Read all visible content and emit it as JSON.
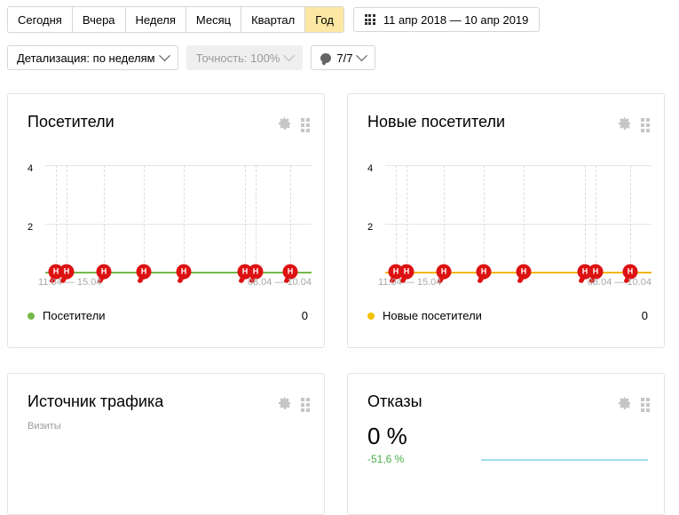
{
  "toolbar": {
    "periods": [
      {
        "label": "Сегодня",
        "active": false
      },
      {
        "label": "Вчера",
        "active": false
      },
      {
        "label": "Неделя",
        "active": false
      },
      {
        "label": "Месяц",
        "active": false
      },
      {
        "label": "Квартал",
        "active": false
      },
      {
        "label": "Год",
        "active": true
      }
    ],
    "date_range": "11 апр 2018 — 10 апр 2019",
    "date_range_icon": "calendar-grid-icon",
    "detail_label": "Детализация: по неделям",
    "accuracy_label": "Точность: 100%",
    "comments_label": "7/7",
    "comments_icon": "speech-bubble-icon",
    "active_tab_color": "#fce8a4"
  },
  "cards": {
    "visitors": {
      "title": "Посетители",
      "gear_icon": "gear-icon",
      "drag_icon": "drag-handle-icon",
      "legend_label": "Посетители",
      "legend_value": "0",
      "legend_color": "#75b94a"
    },
    "new_visitors": {
      "title": "Новые посетители",
      "gear_icon": "gear-icon",
      "drag_icon": "drag-handle-icon",
      "legend_label": "Новые посетители",
      "legend_value": "0",
      "legend_color": "#f2c200"
    },
    "traffic": {
      "title": "Источник трафика",
      "subtitle": "Визиты",
      "gear_icon": "gear-icon",
      "drag_icon": "drag-handle-icon"
    },
    "bounce": {
      "title": "Отказы",
      "gear_icon": "gear-icon",
      "drag_icon": "drag-handle-icon",
      "value": "0 %",
      "delta": "-51,6 %",
      "delta_color": "#49b04a",
      "sparkline_color": "#9fdcf0"
    }
  },
  "chart_data": [
    {
      "type": "line",
      "title": "Посетители",
      "xlabel": "",
      "ylabel": "",
      "ylim": [
        0,
        5
      ],
      "yticks": [
        2,
        4
      ],
      "grid": true,
      "legend": "Посетители",
      "line_color": "#75b94a",
      "x_tick_labels": [
        "11.04 — 15.04",
        "08.04 — 10.04"
      ],
      "series": [
        {
          "name": "Посетители",
          "values": [
            0,
            0,
            0,
            0,
            0,
            0,
            0,
            0
          ]
        }
      ],
      "annotations": [
        {
          "label": "Н",
          "x_pct": 4
        },
        {
          "label": "Н",
          "x_pct": 8
        },
        {
          "label": "Н",
          "x_pct": 22
        },
        {
          "label": "Н",
          "x_pct": 37
        },
        {
          "label": "Н",
          "x_pct": 52
        },
        {
          "label": "Н",
          "x_pct": 75
        },
        {
          "label": "Н",
          "x_pct": 79
        },
        {
          "label": "Н",
          "x_pct": 92
        }
      ],
      "vgrid_pct": [
        4,
        8,
        22,
        37,
        52,
        75,
        79,
        92
      ]
    },
    {
      "type": "line",
      "title": "Новые посетители",
      "xlabel": "",
      "ylabel": "",
      "ylim": [
        0,
        5
      ],
      "yticks": [
        2,
        4
      ],
      "grid": true,
      "legend": "Новые посетители",
      "line_color": "#f2b705",
      "x_tick_labels": [
        "11.04 — 15.04",
        "08.04 — 10.04"
      ],
      "series": [
        {
          "name": "Новые посетители",
          "values": [
            0,
            0,
            0,
            0,
            0,
            0,
            0,
            0
          ]
        }
      ],
      "annotations": [
        {
          "label": "Н",
          "x_pct": 4
        },
        {
          "label": "Н",
          "x_pct": 8
        },
        {
          "label": "Н",
          "x_pct": 22
        },
        {
          "label": "Н",
          "x_pct": 37
        },
        {
          "label": "Н",
          "x_pct": 52
        },
        {
          "label": "Н",
          "x_pct": 75
        },
        {
          "label": "Н",
          "x_pct": 79
        },
        {
          "label": "Н",
          "x_pct": 92
        }
      ],
      "vgrid_pct": [
        4,
        8,
        22,
        37,
        52,
        75,
        79,
        92
      ]
    },
    {
      "type": "line",
      "title": "Отказы",
      "value": "0 %",
      "delta": "-51,6 %",
      "series": [
        {
          "name": "Отказы",
          "values": [
            0,
            0,
            0,
            0,
            0,
            0,
            0,
            0
          ]
        }
      ],
      "line_color": "#9fdcf0",
      "grid": false
    }
  ]
}
